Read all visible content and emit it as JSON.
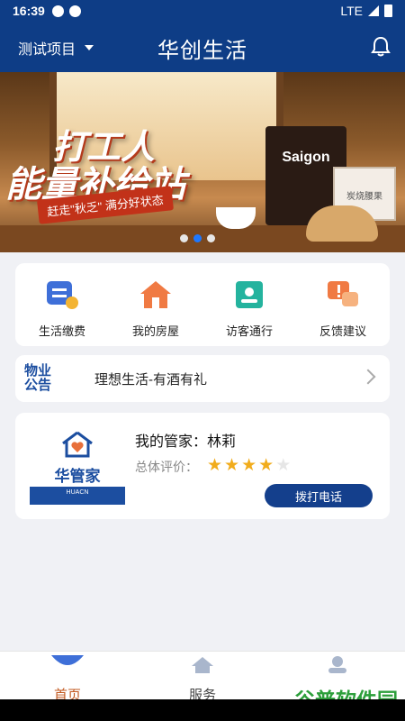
{
  "status": {
    "time": "16:39",
    "network": "LTE"
  },
  "header": {
    "project": "测试项目",
    "title": "华创生活"
  },
  "banner": {
    "headline_1": "打工人",
    "headline_2": "能量补给站",
    "slogan": "赶走\"秋乏\"  满分好状态",
    "product_1": "Saigon",
    "product_2": "炭烧腰果",
    "active_slide": 2,
    "slide_count": 3
  },
  "services": [
    {
      "label": "生活缴费",
      "icon": "wallet-icon"
    },
    {
      "label": "我的房屋",
      "icon": "house-icon"
    },
    {
      "label": "访客通行",
      "icon": "visitor-icon"
    },
    {
      "label": "反馈建议",
      "icon": "feedback-icon"
    }
  ],
  "notice": {
    "badge_1": "物业",
    "badge_2": "公告",
    "text": "理想生活-有酒有礼"
  },
  "steward": {
    "brand": "华管家",
    "strip": "HUACN",
    "name": "我的管家：林莉",
    "rating_label": "总体评价：",
    "rating": 4,
    "rating_max": 5,
    "call_label": "拨打电话"
  },
  "tabs": [
    {
      "label": "首页",
      "active": true
    },
    {
      "label": "服务",
      "active": false
    },
    {
      "label": "",
      "active": false
    }
  ],
  "watermark": "谷普软件园",
  "colors": {
    "primary": "#0e3d86",
    "accent": "#c2571d",
    "star": "#f1ac1c"
  }
}
